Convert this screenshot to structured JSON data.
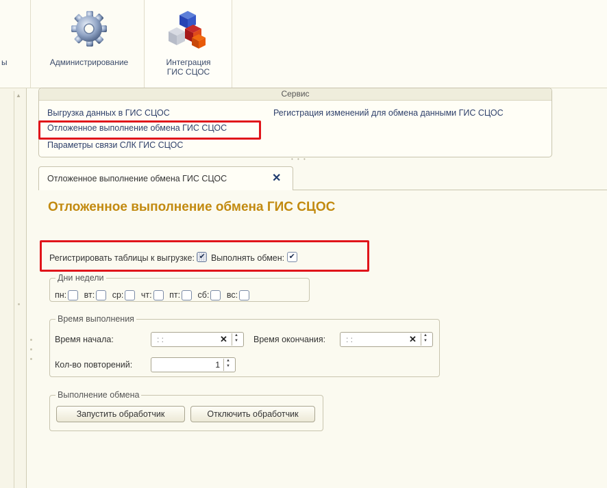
{
  "sections": {
    "cut_label": "ы",
    "admin_label": "Администрирование",
    "gis_label_line1": "Интеграция",
    "gis_label_line2": "ГИС СЦОС"
  },
  "service": {
    "header": "Сервис",
    "links_left": [
      "Выгрузка данных в ГИС СЦОС",
      "Отложенное выполнение обмена ГИС СЦОС",
      "Параметры связи СЛК ГИС СЦОС"
    ],
    "links_right": [
      "Регистрация изменений для обмена данными ГИС СЦОС"
    ]
  },
  "tab": {
    "label": "Отложенное выполнение обмена ГИС СЦОС",
    "close_glyph": "✕"
  },
  "form": {
    "title": "Отложенное выполнение обмена ГИС СЦОС",
    "register_label": "Регистрировать таблицы к выгрузке:",
    "exchange_label": "Выполнять обмен:",
    "register_checked": true,
    "exchange_checked": true,
    "weekdays": {
      "legend": "Дни недели",
      "days": [
        "пн:",
        "вт:",
        "ср:",
        "чт:",
        "пт:",
        "сб:",
        "вс:"
      ]
    },
    "time": {
      "legend": "Время выполнения",
      "start_label": "Время начала:",
      "start_value": ": :",
      "end_label": "Время окончания:",
      "end_value": ": :",
      "repeat_label": "Кол-во повторений:",
      "repeat_value": "1"
    },
    "exec": {
      "legend": "Выполнение обмена",
      "start_button": "Запустить обработчик",
      "stop_button": "Отключить обработчик"
    }
  },
  "colors": {
    "accent_title": "#c28a10",
    "highlight": "#e0141a",
    "link": "#2d3f6a"
  }
}
